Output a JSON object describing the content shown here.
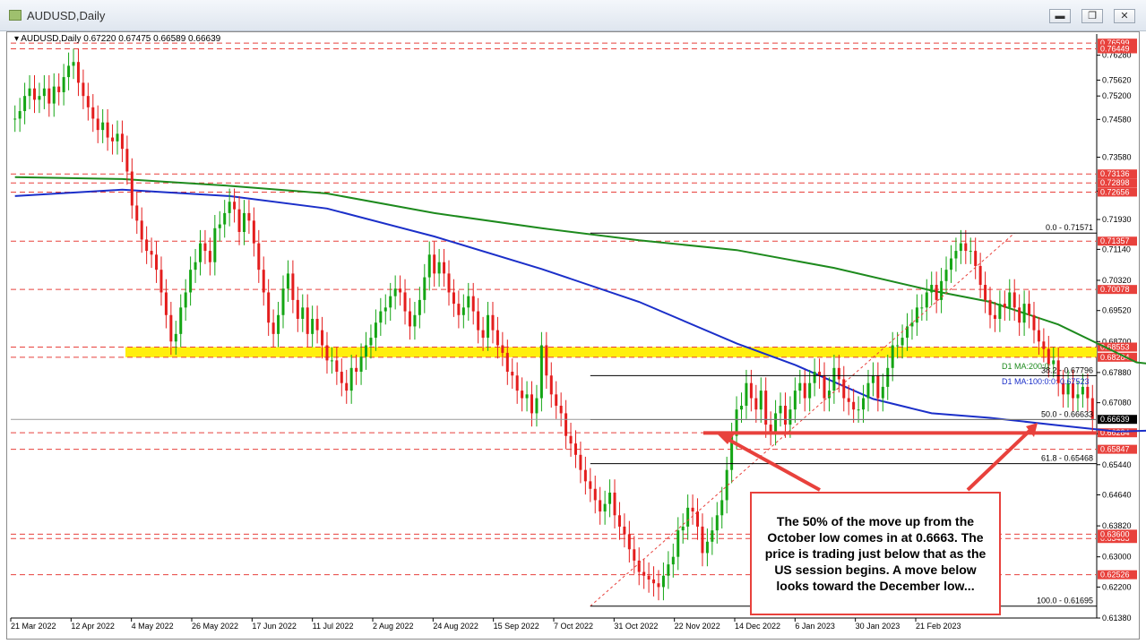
{
  "window": {
    "title": "AUDUSD,Daily",
    "minimize_glyph": "▬",
    "restore_glyph": "❐",
    "close_glyph": "✕"
  },
  "chart_info": {
    "symbol": "AUDUSD,Daily",
    "ohlc": "0.67220 0.67475 0.66589 0.66639"
  },
  "chart_data": {
    "type": "candlestick",
    "y_range": [
      0.6138,
      0.7684
    ],
    "y_ticks": [
      "0.76280",
      "0.75620",
      "0.75200",
      "0.74580",
      "0.73580",
      "0.72680",
      "0.71930",
      "0.71140",
      "0.70320",
      "0.69520",
      "0.68700",
      "0.67880",
      "0.67080",
      "0.66260",
      "0.65440",
      "0.64640",
      "0.63820",
      "0.63000",
      "0.62200",
      "0.61380"
    ],
    "x_ticks": [
      "21 Mar 2022",
      "12 Apr 2022",
      "4 May 2022",
      "26 May 2022",
      "17 Jun 2022",
      "11 Jul 2022",
      "2 Aug 2022",
      "24 Aug 2022",
      "15 Sep 2022",
      "7 Oct 2022",
      "31 Oct 2022",
      "22 Nov 2022",
      "14 Dec 2022",
      "6 Jan 2023",
      "30 Jan 2023",
      "21 Feb 2023"
    ],
    "horizontal_levels": [
      {
        "price": 0.76599,
        "label": "0.76599",
        "color": "#e8413c"
      },
      {
        "price": 0.76449,
        "label": "0.76449",
        "color": "#e8413c"
      },
      {
        "price": 0.73136,
        "label": "0.73136",
        "color": "#e8413c"
      },
      {
        "price": 0.72898,
        "label": "0.72898",
        "color": "#e8413c"
      },
      {
        "price": 0.72656,
        "label": "0.72656",
        "color": "#e8413c"
      },
      {
        "price": 0.71357,
        "label": "0.71357",
        "color": "#e8413c"
      },
      {
        "price": 0.70078,
        "label": "0.70078",
        "color": "#e8413c"
      },
      {
        "price": 0.68553,
        "label": "0.68553",
        "color": "#e8413c"
      },
      {
        "price": 0.68284,
        "label": "0.68284",
        "color": "#e8413c"
      },
      {
        "price": 0.66284,
        "label": "0.66284",
        "color": "#e8413c"
      },
      {
        "price": 0.65847,
        "label": "0.65847",
        "color": "#e8413c"
      },
      {
        "price": 0.63485,
        "label": "0.63485",
        "color": "#e8413c"
      },
      {
        "price": 0.636,
        "label": "0.63600",
        "color": "#e8413c"
      },
      {
        "price": 0.62526,
        "label": "0.62526",
        "color": "#e8413c"
      }
    ],
    "current_price": {
      "price": 0.66639,
      "label": "0.66639"
    },
    "fibonacci": [
      {
        "label": "0.0 - 0.71571",
        "price": 0.71571
      },
      {
        "label": "38.2 - 0.67796",
        "price": 0.67796
      },
      {
        "label": "50.0 - 0.66633",
        "price": 0.66633
      },
      {
        "label": "61.8 - 0.65468",
        "price": 0.65468
      },
      {
        "label": "100.0 - 0.61695",
        "price": 0.61695
      }
    ],
    "ma_labels": {
      "ma200": "D1 MA:200:0:",
      "ma100": "D1 MA:100:0:0: 0.67523"
    },
    "support_zone": [
      0.68284,
      0.68553
    ],
    "colors": {
      "up_candle": "#14a514",
      "down_candle": "#e41d1d",
      "ma100": "#1b2fc9",
      "ma200": "#1d8a1d",
      "level": "#e8413c",
      "zone": "#ffee00"
    },
    "series": [
      {
        "name": "D1 MA:100",
        "x": [
          0,
          22,
          44,
          64,
          86,
          108,
          128,
          148,
          160,
          176,
          188,
          200,
          214,
          226,
          236,
          246,
          256,
          262
        ],
        "y": [
          0.7255,
          0.7272,
          0.7255,
          0.7222,
          0.7148,
          0.7062,
          0.6975,
          0.6865,
          0.6808,
          0.6718,
          0.668,
          0.6668,
          0.6648,
          0.6632,
          0.6635,
          0.6655,
          0.67,
          0.6752
        ]
      },
      {
        "name": "D1 MA:200",
        "x": [
          0,
          22,
          44,
          64,
          86,
          108,
          128,
          148,
          168,
          188,
          200,
          214,
          230,
          246,
          256,
          262
        ],
        "y": [
          0.7305,
          0.73,
          0.7282,
          0.7262,
          0.721,
          0.717,
          0.7138,
          0.7112,
          0.7065,
          0.7005,
          0.6975,
          0.6915,
          0.6815,
          0.679,
          0.6785,
          0.6781
        ]
      }
    ],
    "candles_close": [
      0.746,
      0.748,
      0.752,
      0.754,
      0.751,
      0.752,
      0.754,
      0.75,
      0.7545,
      0.753,
      0.757,
      0.76,
      0.761,
      0.7555,
      0.752,
      0.749,
      0.746,
      0.743,
      0.745,
      0.741,
      0.74,
      0.742,
      0.738,
      0.732,
      0.723,
      0.719,
      0.714,
      0.711,
      0.71,
      0.706,
      0.7,
      0.694,
      0.687,
      0.689,
      0.696,
      0.7,
      0.706,
      0.708,
      0.713,
      0.711,
      0.708,
      0.717,
      0.718,
      0.721,
      0.724,
      0.722,
      0.716,
      0.721,
      0.719,
      0.713,
      0.706,
      0.7,
      0.692,
      0.689,
      0.694,
      0.701,
      0.705,
      0.698,
      0.693,
      0.696,
      0.689,
      0.693,
      0.69,
      0.686,
      0.682,
      0.682,
      0.679,
      0.676,
      0.674,
      0.68,
      0.679,
      0.683,
      0.686,
      0.688,
      0.692,
      0.695,
      0.696,
      0.699,
      0.701,
      0.7,
      0.695,
      0.691,
      0.694,
      0.698,
      0.704,
      0.71,
      0.705,
      0.708,
      0.705,
      0.7,
      0.697,
      0.694,
      0.696,
      0.699,
      0.695,
      0.69,
      0.688,
      0.694,
      0.69,
      0.686,
      0.684,
      0.679,
      0.678,
      0.674,
      0.672,
      0.673,
      0.668,
      0.672,
      0.686,
      0.678,
      0.673,
      0.67,
      0.668,
      0.662,
      0.66,
      0.657,
      0.653,
      0.65,
      0.648,
      0.645,
      0.642,
      0.644,
      0.647,
      0.641,
      0.638,
      0.636,
      0.632,
      0.629,
      0.626,
      0.625,
      0.624,
      0.623,
      0.622,
      0.625,
      0.628,
      0.63,
      0.637,
      0.638,
      0.643,
      0.642,
      0.638,
      0.631,
      0.634,
      0.637,
      0.641,
      0.645,
      0.653,
      0.662,
      0.669,
      0.67,
      0.676,
      0.672,
      0.669,
      0.674,
      0.665,
      0.663,
      0.668,
      0.67,
      0.665,
      0.669,
      0.674,
      0.676,
      0.672,
      0.676,
      0.679,
      0.678,
      0.672,
      0.674,
      0.68,
      0.677,
      0.672,
      0.671,
      0.669,
      0.669,
      0.672,
      0.676,
      0.678,
      0.672,
      0.675,
      0.68,
      0.686,
      0.686,
      0.688,
      0.691,
      0.692,
      0.696,
      0.696,
      0.7,
      0.702,
      0.698,
      0.703,
      0.706,
      0.709,
      0.711,
      0.713,
      0.711,
      0.711,
      0.707,
      0.702,
      0.698,
      0.694,
      0.693,
      0.697,
      0.696,
      0.7,
      0.696,
      0.692,
      0.697,
      0.694,
      0.69,
      0.687,
      0.685,
      0.681,
      0.682,
      0.676,
      0.673,
      0.676,
      0.672,
      0.673,
      0.675,
      0.672,
      0.6664
    ],
    "fib_anchor_low_index": 118,
    "fib_anchor_high_index": 205,
    "annotation": "The 50% of the move up from the October low comes in at 0.6663. The price is trading just below that as the US session begins. A move below looks toward the December low..."
  }
}
